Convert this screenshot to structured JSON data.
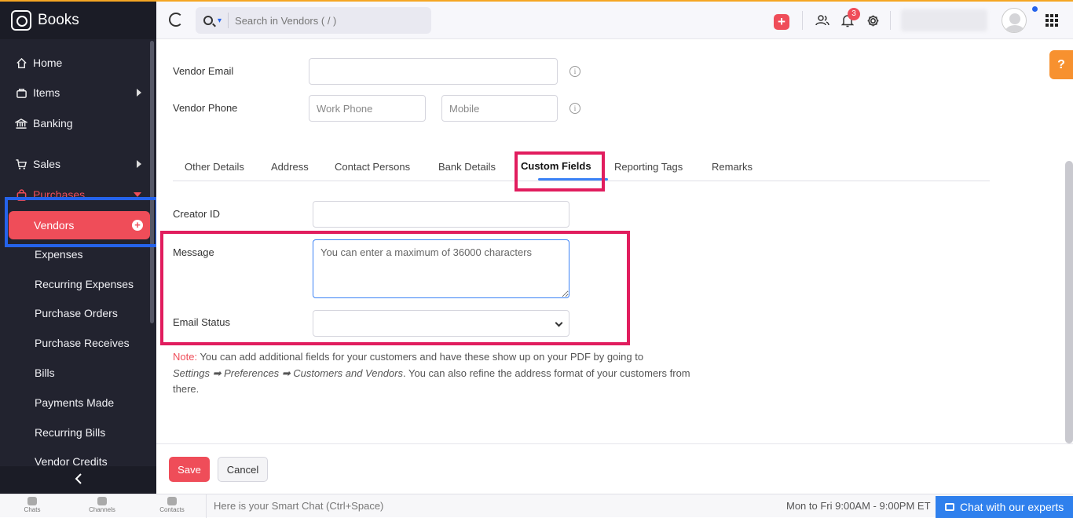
{
  "app": {
    "name": "Books"
  },
  "sidebar": {
    "items": [
      {
        "label": "Home",
        "icon": "home-icon"
      },
      {
        "label": "Items",
        "icon": "bag-icon"
      },
      {
        "label": "Banking",
        "icon": "bank-icon"
      },
      {
        "label": "Sales",
        "icon": "cart-icon"
      },
      {
        "label": "Purchases",
        "icon": "shopping-bag-icon"
      }
    ],
    "purchases_sub": [
      {
        "label": "Vendors"
      },
      {
        "label": "Expenses"
      },
      {
        "label": "Recurring Expenses"
      },
      {
        "label": "Purchase Orders"
      },
      {
        "label": "Purchase Receives"
      },
      {
        "label": "Bills"
      },
      {
        "label": "Payments Made"
      },
      {
        "label": "Recurring Bills"
      },
      {
        "label": "Vendor Credits"
      }
    ],
    "active": "Vendors"
  },
  "topbar": {
    "search_placeholder": "Search in Vendors ( / )",
    "notification_count": "3"
  },
  "form": {
    "vendor_email_label": "Vendor Email",
    "vendor_phone_label": "Vendor Phone",
    "work_phone_placeholder": "Work Phone",
    "mobile_placeholder": "Mobile",
    "tabs": [
      {
        "label": "Other Details"
      },
      {
        "label": "Address"
      },
      {
        "label": "Contact Persons"
      },
      {
        "label": "Bank Details"
      },
      {
        "label": "Custom Fields"
      },
      {
        "label": "Reporting Tags"
      },
      {
        "label": "Remarks"
      }
    ],
    "active_tab": "Custom Fields",
    "creator_id_label": "Creator ID",
    "message_label": "Message",
    "message_placeholder": "You can enter a maximum of 36000 characters",
    "email_status_label": "Email Status",
    "note_prefix": "Note:",
    "note_text_1": " You can add additional fields for your customers and have these show up on your PDF by going to",
    "note_path": "Settings ➡ Preferences ➡ Customers and Vendors",
    "note_text_2": ". You can also refine the address format of your customers from there."
  },
  "actions": {
    "save_label": "Save",
    "cancel_label": "Cancel"
  },
  "help": {
    "label": "?"
  },
  "chatbar": {
    "items": [
      {
        "label": "Chats"
      },
      {
        "label": "Channels"
      },
      {
        "label": "Contacts"
      }
    ],
    "smart_chat_placeholder": "Here is your Smart Chat (Ctrl+Space)",
    "hours": "Mon to Fri 9:00AM - 9:00PM ET",
    "experts_label": "Chat with our experts"
  },
  "colors": {
    "accent": "#ef4d59",
    "highlight_red": "#e11d5e",
    "highlight_blue": "#2563eb",
    "sidebar_bg": "#22232f"
  }
}
